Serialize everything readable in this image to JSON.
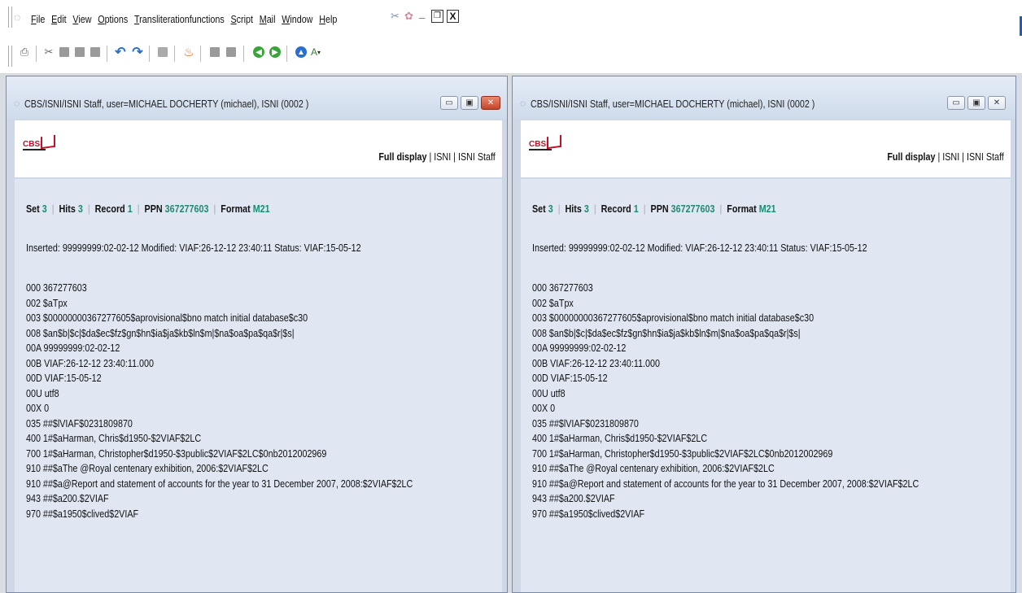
{
  "menubar": {
    "items": [
      "File",
      "Edit",
      "View",
      "Options",
      "Transliterationfunctions",
      "Script",
      "Mail",
      "Window",
      "Help"
    ]
  },
  "toolbar": {
    "icons": [
      "print-icon",
      "cut-icon",
      "copy-icon",
      "paste-icon",
      "save-icon",
      "undo-icon",
      "redo-icon",
      "document-icon",
      "fire-icon",
      "block-icon",
      "block-icon",
      "back-icon",
      "forward-icon",
      "up-icon",
      "font-icon"
    ]
  },
  "windows": [
    {
      "title": "CBS/ISNI/ISNI Staff, user=MICHAEL DOCHERTY (michael), ISNI (0002 )",
      "logo": "CBS",
      "nav": {
        "full_display": "Full display",
        "isni": "ISNI",
        "isni_staff": "ISNI Staff",
        "sep": "|"
      },
      "stats": {
        "set_label": "Set",
        "set": "3",
        "hits_label": "Hits",
        "hits": "3",
        "record_label": "Record",
        "record": "1",
        "ppn_label": "PPN",
        "ppn": "367277603",
        "format_label": "Format",
        "format": "M21"
      },
      "status_line": "Inserted: 99999999:02-02-12 Modified: VIAF:26-12-12 23:40:11 Status: VIAF:15-05-12",
      "lines": [
        "000 367277603",
        "002 $aTpx",
        "003 $00000000367277605$aprovisional$bno match initial database$c30",
        "008 $an$b|$c|$da$ec$fz$gn$hn$ia$ja$kb$ln$m|$na$oa$pa$qa$r|$s|",
        "00A 99999999:02-02-12",
        "00B VIAF:26-12-12 23:40:11.000",
        "00D VIAF:15-05-12",
        "00U utf8",
        "00X 0",
        "035 ##$lVIAF$0231809870",
        "400 1#$aHarman, Chris$d1950-$2VIAF$2LC",
        "700 1#$aHarman, Christopher$d1950-$3public$2VIAF$2LC$0nb2012002969",
        "910 ##$aThe @Royal centenary exhibition, 2006:$2VIAF$2LC",
        "910 ##$a@Report and statement of accounts for the year to 31 December 2007, 2008:$2VIAF$2LC",
        "943 ##$a200.$2VIAF",
        "970 ##$a1950$clived$2VIAF"
      ]
    },
    {
      "title": "CBS/ISNI/ISNI Staff, user=MICHAEL DOCHERTY (michael), ISNI (0002 )",
      "logo": "CBS",
      "nav": {
        "full_display": "Full display",
        "isni": "ISNI",
        "isni_staff": "ISNI Staff",
        "sep": "|"
      },
      "stats": {
        "set_label": "Set",
        "set": "3",
        "hits_label": "Hits",
        "hits": "3",
        "record_label": "Record",
        "record": "1",
        "ppn_label": "PPN",
        "ppn": "367277603",
        "format_label": "Format",
        "format": "M21"
      },
      "status_line": "Inserted: 99999999:02-02-12 Modified: VIAF:26-12-12 23:40:11 Status: VIAF:15-05-12",
      "lines": [
        "000 367277603",
        "002 $aTpx",
        "003 $00000000367277605$aprovisional$bno match initial database$c30",
        "008 $an$b|$c|$da$ec$fz$gn$hn$ia$ja$kb$ln$m|$na$oa$pa$qa$r|$s|",
        "00A 99999999:02-02-12",
        "00B VIAF:26-12-12 23:40:11.000",
        "00D VIAF:15-05-12",
        "00U utf8",
        "00X 0",
        "035 ##$lVIAF$0231809870",
        "400 1#$aHarman, Chris$d1950-$2VIAF$2LC",
        "700 1#$aHarman, Christopher$d1950-$3public$2VIAF$2LC$0nb2012002969",
        "910 ##$aThe @Royal centenary exhibition, 2006:$2VIAF$2LC",
        "910 ##$a@Report and statement of accounts for the year to 31 December 2007, 2008:$2VIAF$2LC",
        "943 ##$a200.$2VIAF",
        "970 ##$a1950$clived$2VIAF"
      ]
    }
  ],
  "colors": {
    "accent_value": "#1e8a72",
    "logo_red": "#c0102a",
    "window_bg": "#cfd8e6"
  }
}
